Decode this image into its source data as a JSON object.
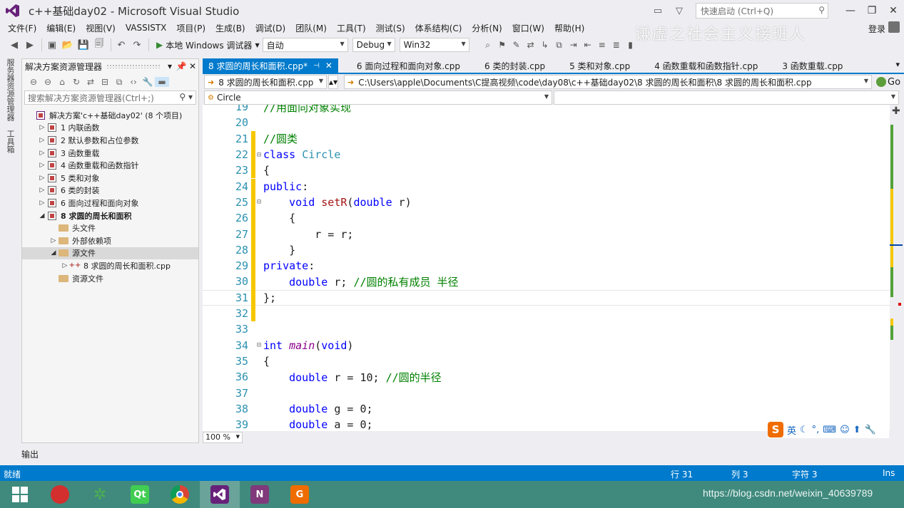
{
  "window": {
    "title": "c++基础day02 - Microsoft Visual Studio",
    "quick_launch_placeholder": "快速启动 (Ctrl+Q)",
    "minimize": "—",
    "restore": "❐",
    "close": "✕",
    "login": "登录",
    "watermark": "谦虚之社会主义接班人"
  },
  "menu": [
    "文件(F)",
    "编辑(E)",
    "视图(V)",
    "VASSISTX",
    "项目(P)",
    "生成(B)",
    "调试(D)",
    "团队(M)",
    "工具(T)",
    "测试(S)",
    "体系结构(C)",
    "分析(N)",
    "窗口(W)",
    "帮助(H)"
  ],
  "toolbar": {
    "run_label": "本地 Windows 调试器",
    "run_mode": "自动",
    "config": "Debug",
    "platform": "Win32"
  },
  "side_tabs": {
    "server_explorer": "服务器资源管理器",
    "toolbox": "工具箱"
  },
  "solution_explorer": {
    "title": "解决方案资源管理器",
    "search_placeholder": "搜索解决方案资源管理器(Ctrl+;)",
    "items": [
      {
        "label": "解决方案'c++基础day02' (8 个项目)",
        "level": 0,
        "exp": "",
        "icon": "solution"
      },
      {
        "label": "1 内联函数",
        "level": 1,
        "exp": "▷",
        "icon": "project"
      },
      {
        "label": "2 默认参数和占位参数",
        "level": 1,
        "exp": "▷",
        "icon": "project"
      },
      {
        "label": "3 函数重载",
        "level": 1,
        "exp": "▷",
        "icon": "project"
      },
      {
        "label": "4 函数重载和函数指针",
        "level": 1,
        "exp": "▷",
        "icon": "project"
      },
      {
        "label": "5 类和对象",
        "level": 1,
        "exp": "▷",
        "icon": "project"
      },
      {
        "label": "6 类的封装",
        "level": 1,
        "exp": "▷",
        "icon": "project"
      },
      {
        "label": "6 面向过程和面向对象",
        "level": 1,
        "exp": "▷",
        "icon": "project"
      },
      {
        "label": "8 求圆的周长和面积",
        "level": 1,
        "exp": "◢",
        "icon": "project",
        "bold": true
      },
      {
        "label": "头文件",
        "level": 2,
        "exp": "",
        "icon": "folder"
      },
      {
        "label": "外部依赖项",
        "level": 2,
        "exp": "▷",
        "icon": "folder"
      },
      {
        "label": "源文件",
        "level": 2,
        "exp": "◢",
        "icon": "folder",
        "highlight": true
      },
      {
        "label": "8 求圆的周长和面积.cpp",
        "level": 3,
        "exp": "▷",
        "icon": "cpp"
      },
      {
        "label": "资源文件",
        "level": 2,
        "exp": "",
        "icon": "folder"
      }
    ]
  },
  "tabs": [
    {
      "label": "8 求圆的周长和面积.cpp*",
      "active": true
    },
    {
      "label": "6 面向过程和面向对象.cpp",
      "active": false
    },
    {
      "label": "6 类的封装.cpp",
      "active": false
    },
    {
      "label": "5 类和对象.cpp",
      "active": false
    },
    {
      "label": "4 函数重载和函数指针.cpp",
      "active": false
    },
    {
      "label": "3 函数重载.cpp",
      "active": false
    }
  ],
  "navbar": {
    "file": "8 求圆的周长和面积.cpp",
    "path": "C:\\Users\\apple\\Documents\\C提高视频\\code\\day08\\c++基础day02\\8 求圆的周长和面积\\8 求圆的周长和面积.cpp",
    "go": "Go",
    "scope": "Circle"
  },
  "editor": {
    "lines": [
      {
        "n": "19",
        "html": "<span class=\"cm\">//用面向对象实现</span>"
      },
      {
        "n": "20",
        "html": ""
      },
      {
        "n": "21",
        "html": "<span class=\"cm\">//圆类</span>",
        "chg": true
      },
      {
        "n": "22",
        "html": "<span class=\"kw\">class</span> <span class=\"ty\">Circle</span>",
        "chg": true,
        "fold": "⊟"
      },
      {
        "n": "23",
        "html": "{",
        "chg": true
      },
      {
        "n": "24",
        "html": "<span class=\"kw\">public</span>:",
        "chg": true
      },
      {
        "n": "25",
        "html": "    <span class=\"kw\">void</span> <span class=\"fn\">setR</span>(<span class=\"kw\">double</span> r)",
        "chg": true,
        "fold": "⊟"
      },
      {
        "n": "26",
        "html": "    {",
        "chg": true
      },
      {
        "n": "27",
        "html": "        r = r;",
        "chg": true
      },
      {
        "n": "28",
        "html": "    }",
        "chg": true
      },
      {
        "n": "29",
        "html": "<span class=\"kw\">private</span>:",
        "chg": true
      },
      {
        "n": "30",
        "html": "    <span class=\"kw\">double</span> r; <span class=\"cm\">//圆的私有成员 半径</span>",
        "chg": true
      },
      {
        "n": "31",
        "html": "};",
        "chg": true,
        "current": true
      },
      {
        "n": "32",
        "html": "",
        "chg": true
      },
      {
        "n": "33",
        "html": ""
      },
      {
        "n": "34",
        "html": "<span class=\"kw\">int</span> <span class=\"fi\">main</span>(<span class=\"kw\">void</span>)",
        "fold": "⊟"
      },
      {
        "n": "35",
        "html": "{"
      },
      {
        "n": "36",
        "html": "    <span class=\"kw\">double</span> r = 10; <span class=\"cm\">//圆的半径</span>"
      },
      {
        "n": "37",
        "html": ""
      },
      {
        "n": "38",
        "html": "    <span class=\"kw\">double</span> g = 0;"
      },
      {
        "n": "39",
        "html": "    <span class=\"kw\">double</span> a = 0;"
      }
    ]
  },
  "zoom": "100 %",
  "ime": {
    "logo": "S",
    "lang": "英"
  },
  "output_label": "输出",
  "status": {
    "ready": "就绪",
    "line": "行 31",
    "col": "列 3",
    "char": "字符 3",
    "ins": "Ins"
  },
  "taskbar": {
    "url_watermark": "https://blog.csdn.net/weixin_40639789"
  }
}
